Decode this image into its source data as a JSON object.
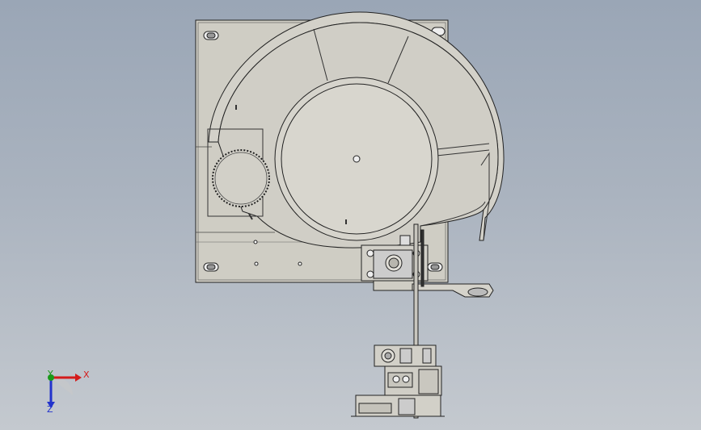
{
  "triad": {
    "x_label": "X",
    "y_label": "Y",
    "z_label": "Z"
  },
  "colors": {
    "background_top": "#9aa6b6",
    "background_bottom": "#c4c9cf",
    "part_fill": "#cfcdc4",
    "part_fill_light": "#d8d6ce",
    "edge": "#202020",
    "x_axis": "#d41b1b",
    "y_axis": "#1a9a1a",
    "z_axis": "#2233cc"
  }
}
